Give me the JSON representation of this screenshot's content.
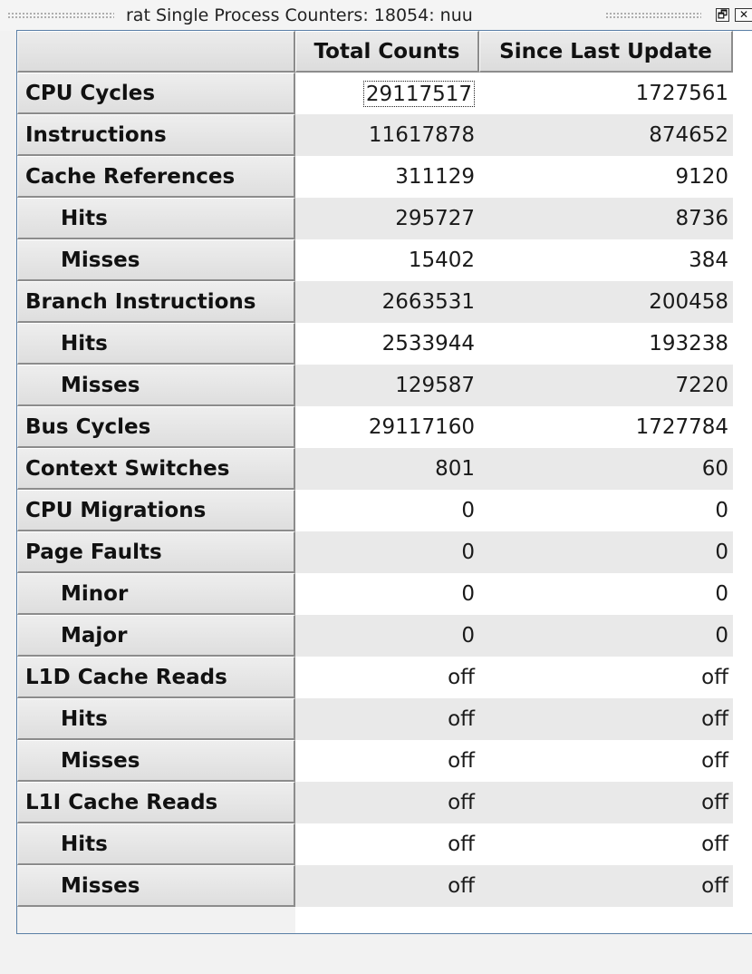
{
  "window": {
    "title": "rat Single Process Counters: 18054: nuu",
    "restore_glyph": "🗗",
    "close_glyph": "✕"
  },
  "table": {
    "columns": [
      "",
      "Total Counts",
      "Since Last Update"
    ],
    "rows": [
      {
        "label": "CPU Cycles",
        "indent": false,
        "total": "29117517",
        "since": "1727561"
      },
      {
        "label": "Instructions",
        "indent": false,
        "total": "11617878",
        "since": "874652"
      },
      {
        "label": "Cache References",
        "indent": false,
        "total": "311129",
        "since": "9120"
      },
      {
        "label": "Hits",
        "indent": true,
        "total": "295727",
        "since": "8736"
      },
      {
        "label": "Misses",
        "indent": true,
        "total": "15402",
        "since": "384"
      },
      {
        "label": "Branch Instructions",
        "indent": false,
        "total": "2663531",
        "since": "200458"
      },
      {
        "label": "Hits",
        "indent": true,
        "total": "2533944",
        "since": "193238"
      },
      {
        "label": "Misses",
        "indent": true,
        "total": "129587",
        "since": "7220"
      },
      {
        "label": "Bus Cycles",
        "indent": false,
        "total": "29117160",
        "since": "1727784"
      },
      {
        "label": "Context Switches",
        "indent": false,
        "total": "801",
        "since": "60"
      },
      {
        "label": "CPU Migrations",
        "indent": false,
        "total": "0",
        "since": "0"
      },
      {
        "label": "Page Faults",
        "indent": false,
        "total": "0",
        "since": "0"
      },
      {
        "label": "Minor",
        "indent": true,
        "total": "0",
        "since": "0"
      },
      {
        "label": "Major",
        "indent": true,
        "total": "0",
        "since": "0"
      },
      {
        "label": "L1D Cache Reads",
        "indent": false,
        "total": "off",
        "since": "off"
      },
      {
        "label": "Hits",
        "indent": true,
        "total": "off",
        "since": "off"
      },
      {
        "label": "Misses",
        "indent": true,
        "total": "off",
        "since": "off"
      },
      {
        "label": "L1I Cache Reads",
        "indent": false,
        "total": "off",
        "since": "off"
      },
      {
        "label": "Hits",
        "indent": true,
        "total": "off",
        "since": "off"
      },
      {
        "label": "Misses",
        "indent": true,
        "total": "off",
        "since": "off"
      }
    ]
  }
}
